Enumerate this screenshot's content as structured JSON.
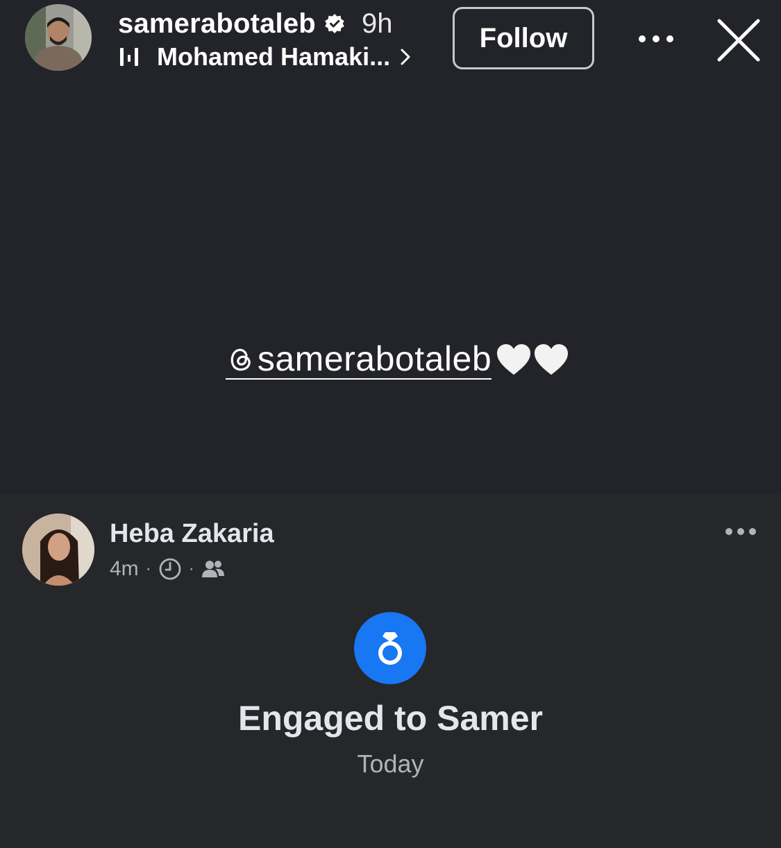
{
  "story": {
    "username": "samerabotaleb",
    "time_ago": "9h",
    "music_title": "Mohamed Hamaki...",
    "follow_label": "Follow",
    "mention_text": "samerabotaleb"
  },
  "post": {
    "author": "Heba Zakaria",
    "time": "4m",
    "event_title": "Engaged to Samer",
    "event_date": "Today"
  },
  "icons": {
    "verified": "verified-badge-icon",
    "music": "music-bars-icon",
    "chevron": "chevron-right-icon",
    "more": "more-horizontal-icon",
    "close": "close-icon",
    "threads": "threads-icon",
    "heart": "white-heart-icon",
    "clock": "clock-icon",
    "friends": "friends-icon",
    "ring": "ring-icon"
  },
  "colors": {
    "background": "#232429",
    "card_background": "#26272b",
    "accent": "#1877f2",
    "secondary_text": "#b0b3b8"
  }
}
